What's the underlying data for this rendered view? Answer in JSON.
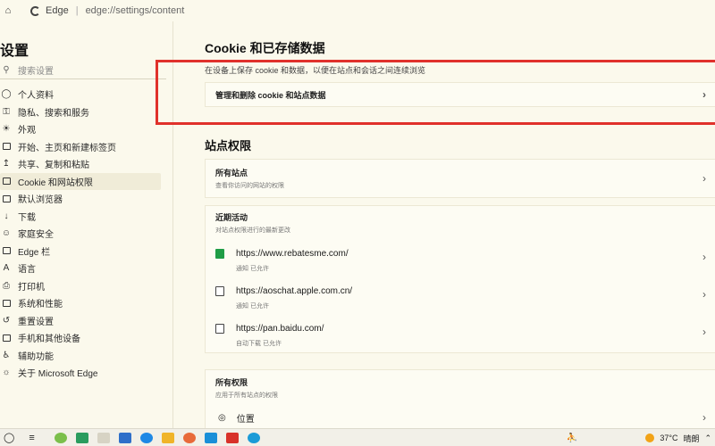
{
  "topbar": {
    "browser_name": "Edge",
    "separator": "|",
    "url": "edge://settings/content"
  },
  "sidebar": {
    "title": "设置",
    "search_placeholder": "搜索设置",
    "items": [
      {
        "label": "个人资料",
        "icon": "profile-icon"
      },
      {
        "label": "隐私、搜索和服务",
        "icon": "lock-icon"
      },
      {
        "label": "外观",
        "icon": "appearance-icon"
      },
      {
        "label": "开始、主页和新建标签页",
        "icon": "start-page-icon"
      },
      {
        "label": "共享、复制和粘贴",
        "icon": "share-icon"
      },
      {
        "label": "Cookie 和网站权限",
        "icon": "cookie-icon",
        "active": true
      },
      {
        "label": "默认浏览器",
        "icon": "browser-icon"
      },
      {
        "label": "下载",
        "icon": "download-icon"
      },
      {
        "label": "家庭安全",
        "icon": "family-icon"
      },
      {
        "label": "Edge 栏",
        "icon": "edge-bar-icon"
      },
      {
        "label": "语言",
        "icon": "language-icon"
      },
      {
        "label": "打印机",
        "icon": "printer-icon"
      },
      {
        "label": "系统和性能",
        "icon": "system-icon"
      },
      {
        "label": "重置设置",
        "icon": "reset-icon"
      },
      {
        "label": "手机和其他设备",
        "icon": "phone-icon"
      },
      {
        "label": "辅助功能",
        "icon": "accessibility-icon"
      },
      {
        "label": "关于 Microsoft Edge",
        "icon": "edge-logo-icon"
      }
    ]
  },
  "main": {
    "cookie_section": {
      "title": "Cookie 和已存储数据",
      "description": "在设备上保存 cookie 和数据，以便在站点和会话之间连续浏览",
      "manage_label": "管理和删除 cookie 和站点数据"
    },
    "permissions_section": {
      "title": "站点权限",
      "all_sites_title": "所有站点",
      "all_sites_desc": "查看你访问的网站的权限",
      "recent_title": "近期活动",
      "recent_desc": "对站点权限进行的最新更改",
      "sites": [
        {
          "url": "https://www.rebatesme.com/",
          "meta": "通知 已允许",
          "favicon": "green"
        },
        {
          "url": "https://aoschat.apple.com.cn/",
          "meta": "通知 已允许",
          "favicon": "page"
        },
        {
          "url": "https://pan.baidu.com/",
          "meta": "自动下载 已允许",
          "favicon": "page"
        }
      ],
      "all_permissions_title": "所有权限",
      "all_permissions_desc": "应用于所有站点的权限",
      "location_label": "位置"
    }
  },
  "taskbar": {
    "temperature": "37°C",
    "weather": "晴朗"
  }
}
